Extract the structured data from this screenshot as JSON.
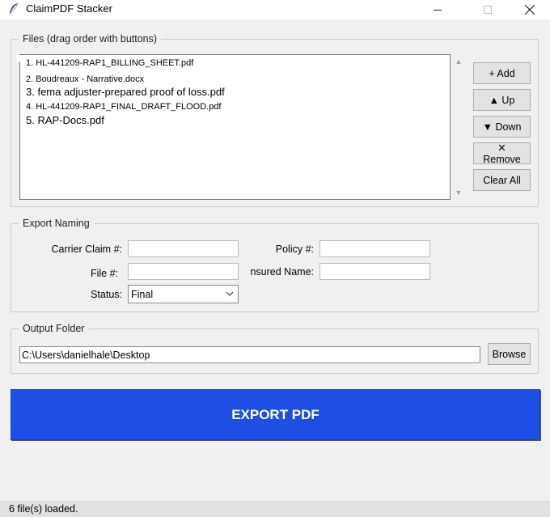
{
  "window": {
    "title": "ClaimPDF Stacker"
  },
  "files": {
    "group_label": "Files (drag order with buttons)",
    "items": [
      "1. HL-441209-RAP1_BILLING_SHEET.pdf",
      "2. Boudreaux - Narrative.docx",
      "3. fema adjuster-prepared proof of loss.pdf",
      "4. HL-441209-RAP1_FINAL_DRAFT_FLOOD.pdf",
      "5. RAP-Docs.pdf"
    ],
    "buttons": {
      "add": "+ Add",
      "up": "▲ Up",
      "down": "▼ Down",
      "remove": "✕ Remove",
      "clear_all": "Clear All"
    }
  },
  "export_naming": {
    "group_label": "Export Naming",
    "carrier_claim_label": "Carrier Claim #:",
    "carrier_claim_value": "",
    "policy_label": "Policy #:",
    "policy_value": "",
    "file_label": "File #:",
    "file_value": "",
    "insured_name_label": "nsured Name:",
    "insured_name_value": "",
    "status_label": "Status:",
    "status_value": "Final"
  },
  "output": {
    "group_label": "Output Folder",
    "path": "C:\\Users\\danielhale\\Desktop",
    "browse_label": "Browse"
  },
  "export_button": "EXPORT PDF",
  "status_bar": "6 file(s) loaded.",
  "colors": {
    "export_button_bg": "#1e4ee4",
    "window_bg": "#f0f0f0"
  }
}
